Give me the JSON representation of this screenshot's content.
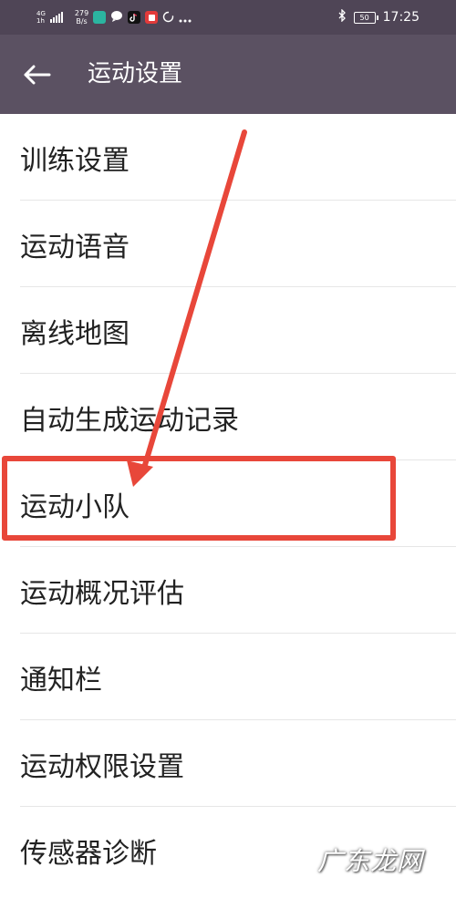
{
  "status_bar": {
    "network_type_top": "4G",
    "network_type_bottom": "1h",
    "speed_value": "279",
    "speed_unit": "B/s",
    "battery": "50",
    "time": "17:25",
    "icons": [
      "signal-icon",
      "app-icon",
      "message-icon",
      "tiktok-icon",
      "notification-icon",
      "sync-icon",
      "more-icon",
      "bluetooth-icon",
      "battery-icon"
    ]
  },
  "app_bar": {
    "back_icon": "arrow-left-icon",
    "title": "运动设置"
  },
  "menu": {
    "items": [
      {
        "label": "训练设置"
      },
      {
        "label": "运动语音"
      },
      {
        "label": "离线地图"
      },
      {
        "label": "自动生成运动记录"
      },
      {
        "label": "运动小队"
      },
      {
        "label": "运动概况评估"
      },
      {
        "label": "通知栏"
      },
      {
        "label": "运动权限设置"
      },
      {
        "label": "传感器诊断"
      }
    ]
  },
  "annotation": {
    "color": "#e8473a",
    "highlighted_item": "运动小队"
  },
  "watermark": {
    "text": "广东龙网"
  },
  "colors": {
    "status_bar_bg": "#4f4556",
    "app_bar_bg": "#5b5162",
    "text": "#222222",
    "divider": "#e6e6e6"
  }
}
